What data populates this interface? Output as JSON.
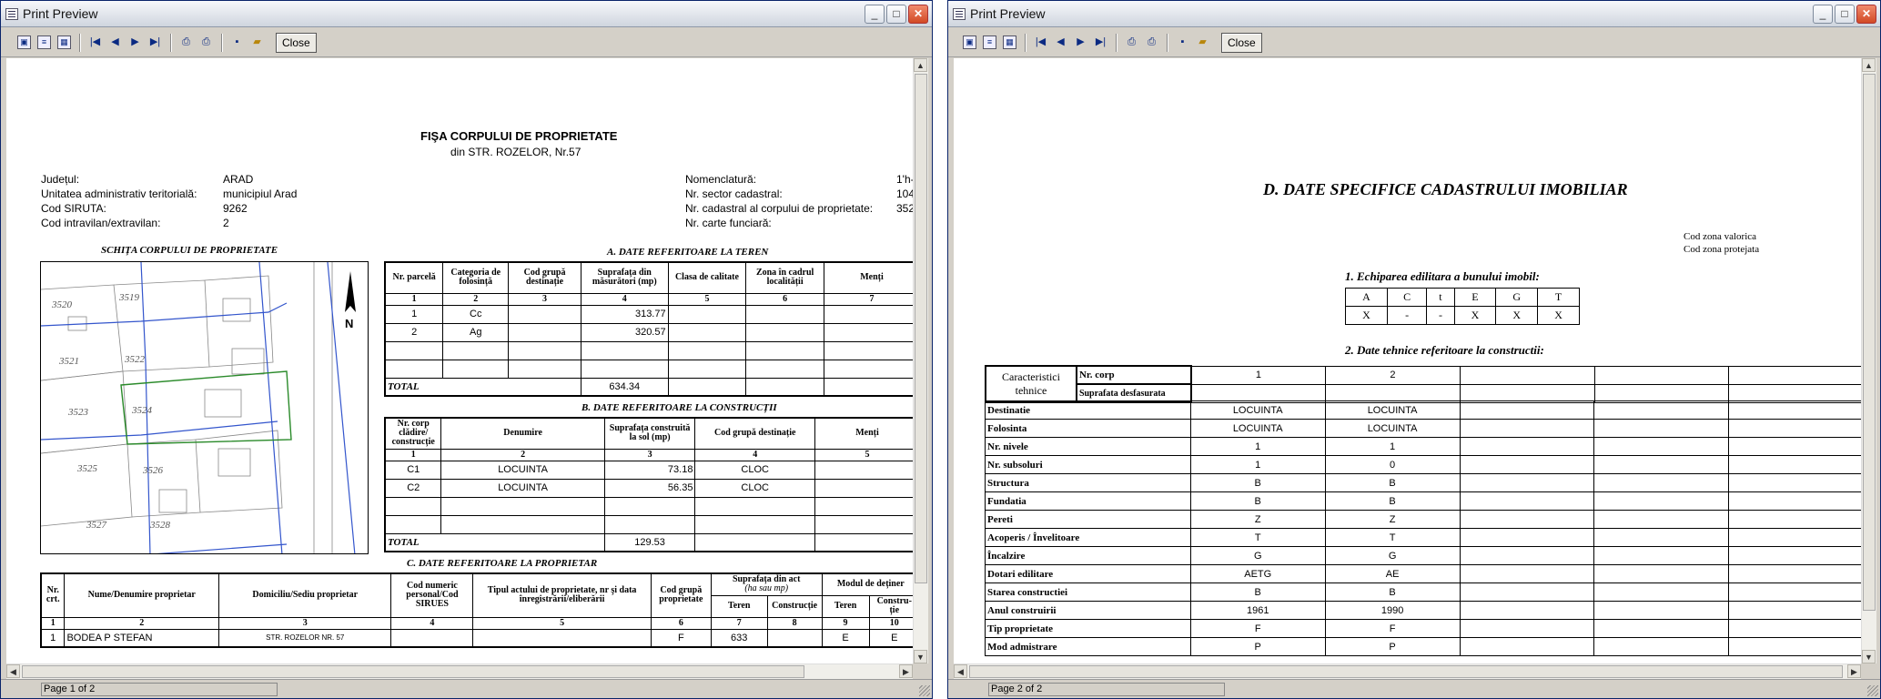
{
  "windows": [
    {
      "title": "Print Preview",
      "close_label": "Close",
      "status": "Page 1 of 2"
    },
    {
      "title": "Print Preview",
      "close_label": "Close",
      "status": "Page 2 of 2"
    }
  ],
  "page1": {
    "title": "FIŞA CORPULUI DE PROPRIETATE",
    "subtitle": "din STR. ROZELOR, Nr.57",
    "left_info": [
      {
        "label": "Județul:",
        "value": "ARAD"
      },
      {
        "label": "Unitatea administrativ teritorială:",
        "value": "municipiul Arad"
      },
      {
        "label": "Cod SIRUTA:",
        "value": "9262"
      },
      {
        "label": "Cod intravilan/extravilan:",
        "value": "2"
      }
    ],
    "right_info": [
      {
        "label": "Nomenclatură:",
        "value": "1'h-"
      },
      {
        "label": "Nr. sector cadastral:",
        "value": "104"
      },
      {
        "label": "Nr. cadastral al corpului de proprietate:",
        "value": "352"
      },
      {
        "label": "Nr. carte funciară:",
        "value": ""
      }
    ],
    "sketch_title": "SCHIȚA CORPULUI DE PROPRIETATE",
    "map_labels": [
      "3520",
      "3519",
      "3521",
      "3522",
      "3523",
      "3524",
      "3525",
      "3526",
      "3527",
      "3528"
    ],
    "map_north": "N",
    "sectionA": {
      "title": "A. DATE REFERITOARE LA TEREN",
      "headers": [
        "Nr. parcelă",
        "Categoria de folosință",
        "Cod grupă destinație",
        "Suprafața din măsurători (mp)",
        "Clasa de calitate",
        "Zona în cadrul localității",
        "Menți"
      ],
      "numbers": [
        "1",
        "2",
        "3",
        "4",
        "5",
        "6",
        "7"
      ],
      "rows": [
        [
          "1",
          "Cc",
          "",
          "313.77",
          "",
          "",
          ""
        ],
        [
          "2",
          "Ag",
          "",
          "320.57",
          "",
          "",
          ""
        ],
        [
          "",
          "",
          "",
          "",
          "",
          "",
          ""
        ],
        [
          "",
          "",
          "",
          "",
          "",
          "",
          ""
        ]
      ],
      "total_label": "TOTAL",
      "total": "634.34"
    },
    "sectionB": {
      "title": "B. DATE REFERITOARE LA CONSTRUCȚII",
      "headers": [
        "Nr. corp clădire/ construcție",
        "Denumire",
        "Suprafața construită la sol (mp)",
        "Cod grupă destinație",
        "Menți"
      ],
      "numbers": [
        "1",
        "2",
        "3",
        "4",
        "5"
      ],
      "rows": [
        [
          "C1",
          "LOCUINTA",
          "73.18",
          "CLOC",
          ""
        ],
        [
          "C2",
          "LOCUINTA",
          "56.35",
          "CLOC",
          ""
        ],
        [
          "",
          "",
          "",
          "",
          ""
        ],
        [
          "",
          "",
          "",
          "",
          ""
        ]
      ],
      "total_label": "TOTAL",
      "total": "129.53"
    },
    "sectionC": {
      "title": "C. DATE REFERITOARE LA PROPRIETAR",
      "headers": [
        "Nr. crt.",
        "Nume/Denumire proprietar",
        "Domiciliu/Sediu proprietar",
        "Cod numeric personal/Cod SIRUES",
        "Tipul actului de proprietate, nr şi data înregistrării/eliberării",
        "Cod grupă proprietate",
        "Suprafața din act",
        "Modul de deținer"
      ],
      "act_units": "(ha sau mp)",
      "sub_headers": [
        "Teren",
        "Construcție",
        "Teren",
        "Constru- ție"
      ],
      "numbers": [
        "1",
        "2",
        "3",
        "4",
        "5",
        "6",
        "7",
        "8",
        "9",
        "10"
      ],
      "rows": [
        [
          "1",
          "BODEA P STEFAN",
          "STR. ROZELOR NR. 57",
          "",
          "",
          "F",
          "633",
          "",
          "E",
          "E"
        ]
      ]
    }
  },
  "page2": {
    "title": "D. DATE SPECIFICE CADASTRULUI IMOBILIAR",
    "cod_zona_valorica": "Cod zona valorica",
    "cod_zona_protejata": "Cod zona protejata",
    "echipare_title": "1. Echiparea edilitara a bunului imobil:",
    "echipare_headers": [
      "A",
      "C",
      "t",
      "E",
      "G",
      "T"
    ],
    "echipare_values": [
      "X",
      "-",
      "-",
      "X",
      "X",
      "X"
    ],
    "tehnice_title": "2. Date tehnice referitoare la constructii:",
    "caract_label": "Caracteristici tehnice",
    "nr_corp_label": "Nr. corp",
    "suprafata_label": "Suprafata desfasurata",
    "corp_numbers": [
      "1",
      "2",
      "",
      "",
      ""
    ],
    "rows": [
      {
        "label": "Destinatie",
        "values": [
          "LOCUINTA",
          "LOCUINTA"
        ]
      },
      {
        "label": "Folosinta",
        "values": [
          "LOCUINTA",
          "LOCUINTA"
        ]
      },
      {
        "label": "Nr. nivele",
        "values": [
          "1",
          "1"
        ]
      },
      {
        "label": "Nr. subsoluri",
        "values": [
          "1",
          "0"
        ]
      },
      {
        "label": "Structura",
        "values": [
          "B",
          "B"
        ]
      },
      {
        "label": "Fundatia",
        "values": [
          "B",
          "B"
        ]
      },
      {
        "label": "Pereti",
        "values": [
          "Z",
          "Z"
        ]
      },
      {
        "label": "Acoperis / Învelitoare",
        "values": [
          "T",
          "T"
        ]
      },
      {
        "label": "Încalzire",
        "values": [
          "G",
          "G"
        ]
      },
      {
        "label": "Dotari edilitare",
        "values": [
          "AETG",
          "AE"
        ]
      },
      {
        "label": "Starea constructiei",
        "values": [
          "B",
          "B"
        ]
      },
      {
        "label": "Anul construirii",
        "values": [
          "1961",
          "1990"
        ]
      },
      {
        "label": "Tip proprietate",
        "values": [
          "F",
          "F"
        ]
      },
      {
        "label": "Mod admistrare",
        "values": [
          "P",
          "P"
        ]
      }
    ]
  }
}
